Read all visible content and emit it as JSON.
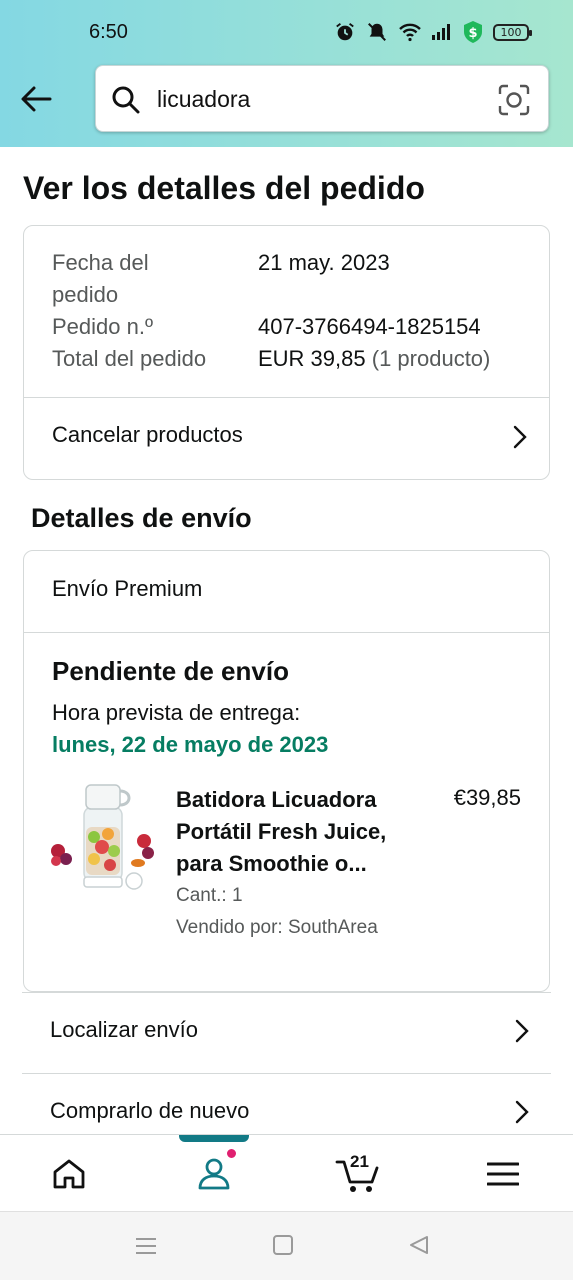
{
  "status_bar": {
    "time": "6:50",
    "battery": "100"
  },
  "search": {
    "query": "licuadora"
  },
  "page": {
    "title": "Ver los detalles del pedido"
  },
  "order": {
    "date_label_line1": "Fecha del",
    "date_label_line2": "pedido",
    "date_value": "21 may. 2023",
    "number_label": "Pedido n.º",
    "number_value": "407-3766494-1825154",
    "total_label": "Total del pedido",
    "total_value": "EUR 39,85",
    "total_count": "(1 producto)",
    "cancel_label": "Cancelar productos"
  },
  "shipping": {
    "section_title": "Detalles de envío",
    "type": "Envío Premium",
    "status": "Pendiente de envío",
    "eta_label": "Hora prevista de entrega:",
    "eta_date": "lunes, 22 de mayo de 2023",
    "product": {
      "name": "Batidora Licuadora Portátil Fresh Juice, para Smoothie o...",
      "price": "€39,85",
      "qty": "Cant.: 1",
      "seller": "Vendido por: SouthArea"
    }
  },
  "actions": {
    "track_label": "Localizar envío",
    "buy_again_label": "Comprarlo de nuevo"
  },
  "bottom_nav": {
    "cart_count": "21",
    "active_tab": "account",
    "accent_color": "#127a86"
  },
  "colors": {
    "eta_green": "#067d62",
    "header_gradient_start": "#84d8e3",
    "header_gradient_end": "#a6e6cf"
  }
}
